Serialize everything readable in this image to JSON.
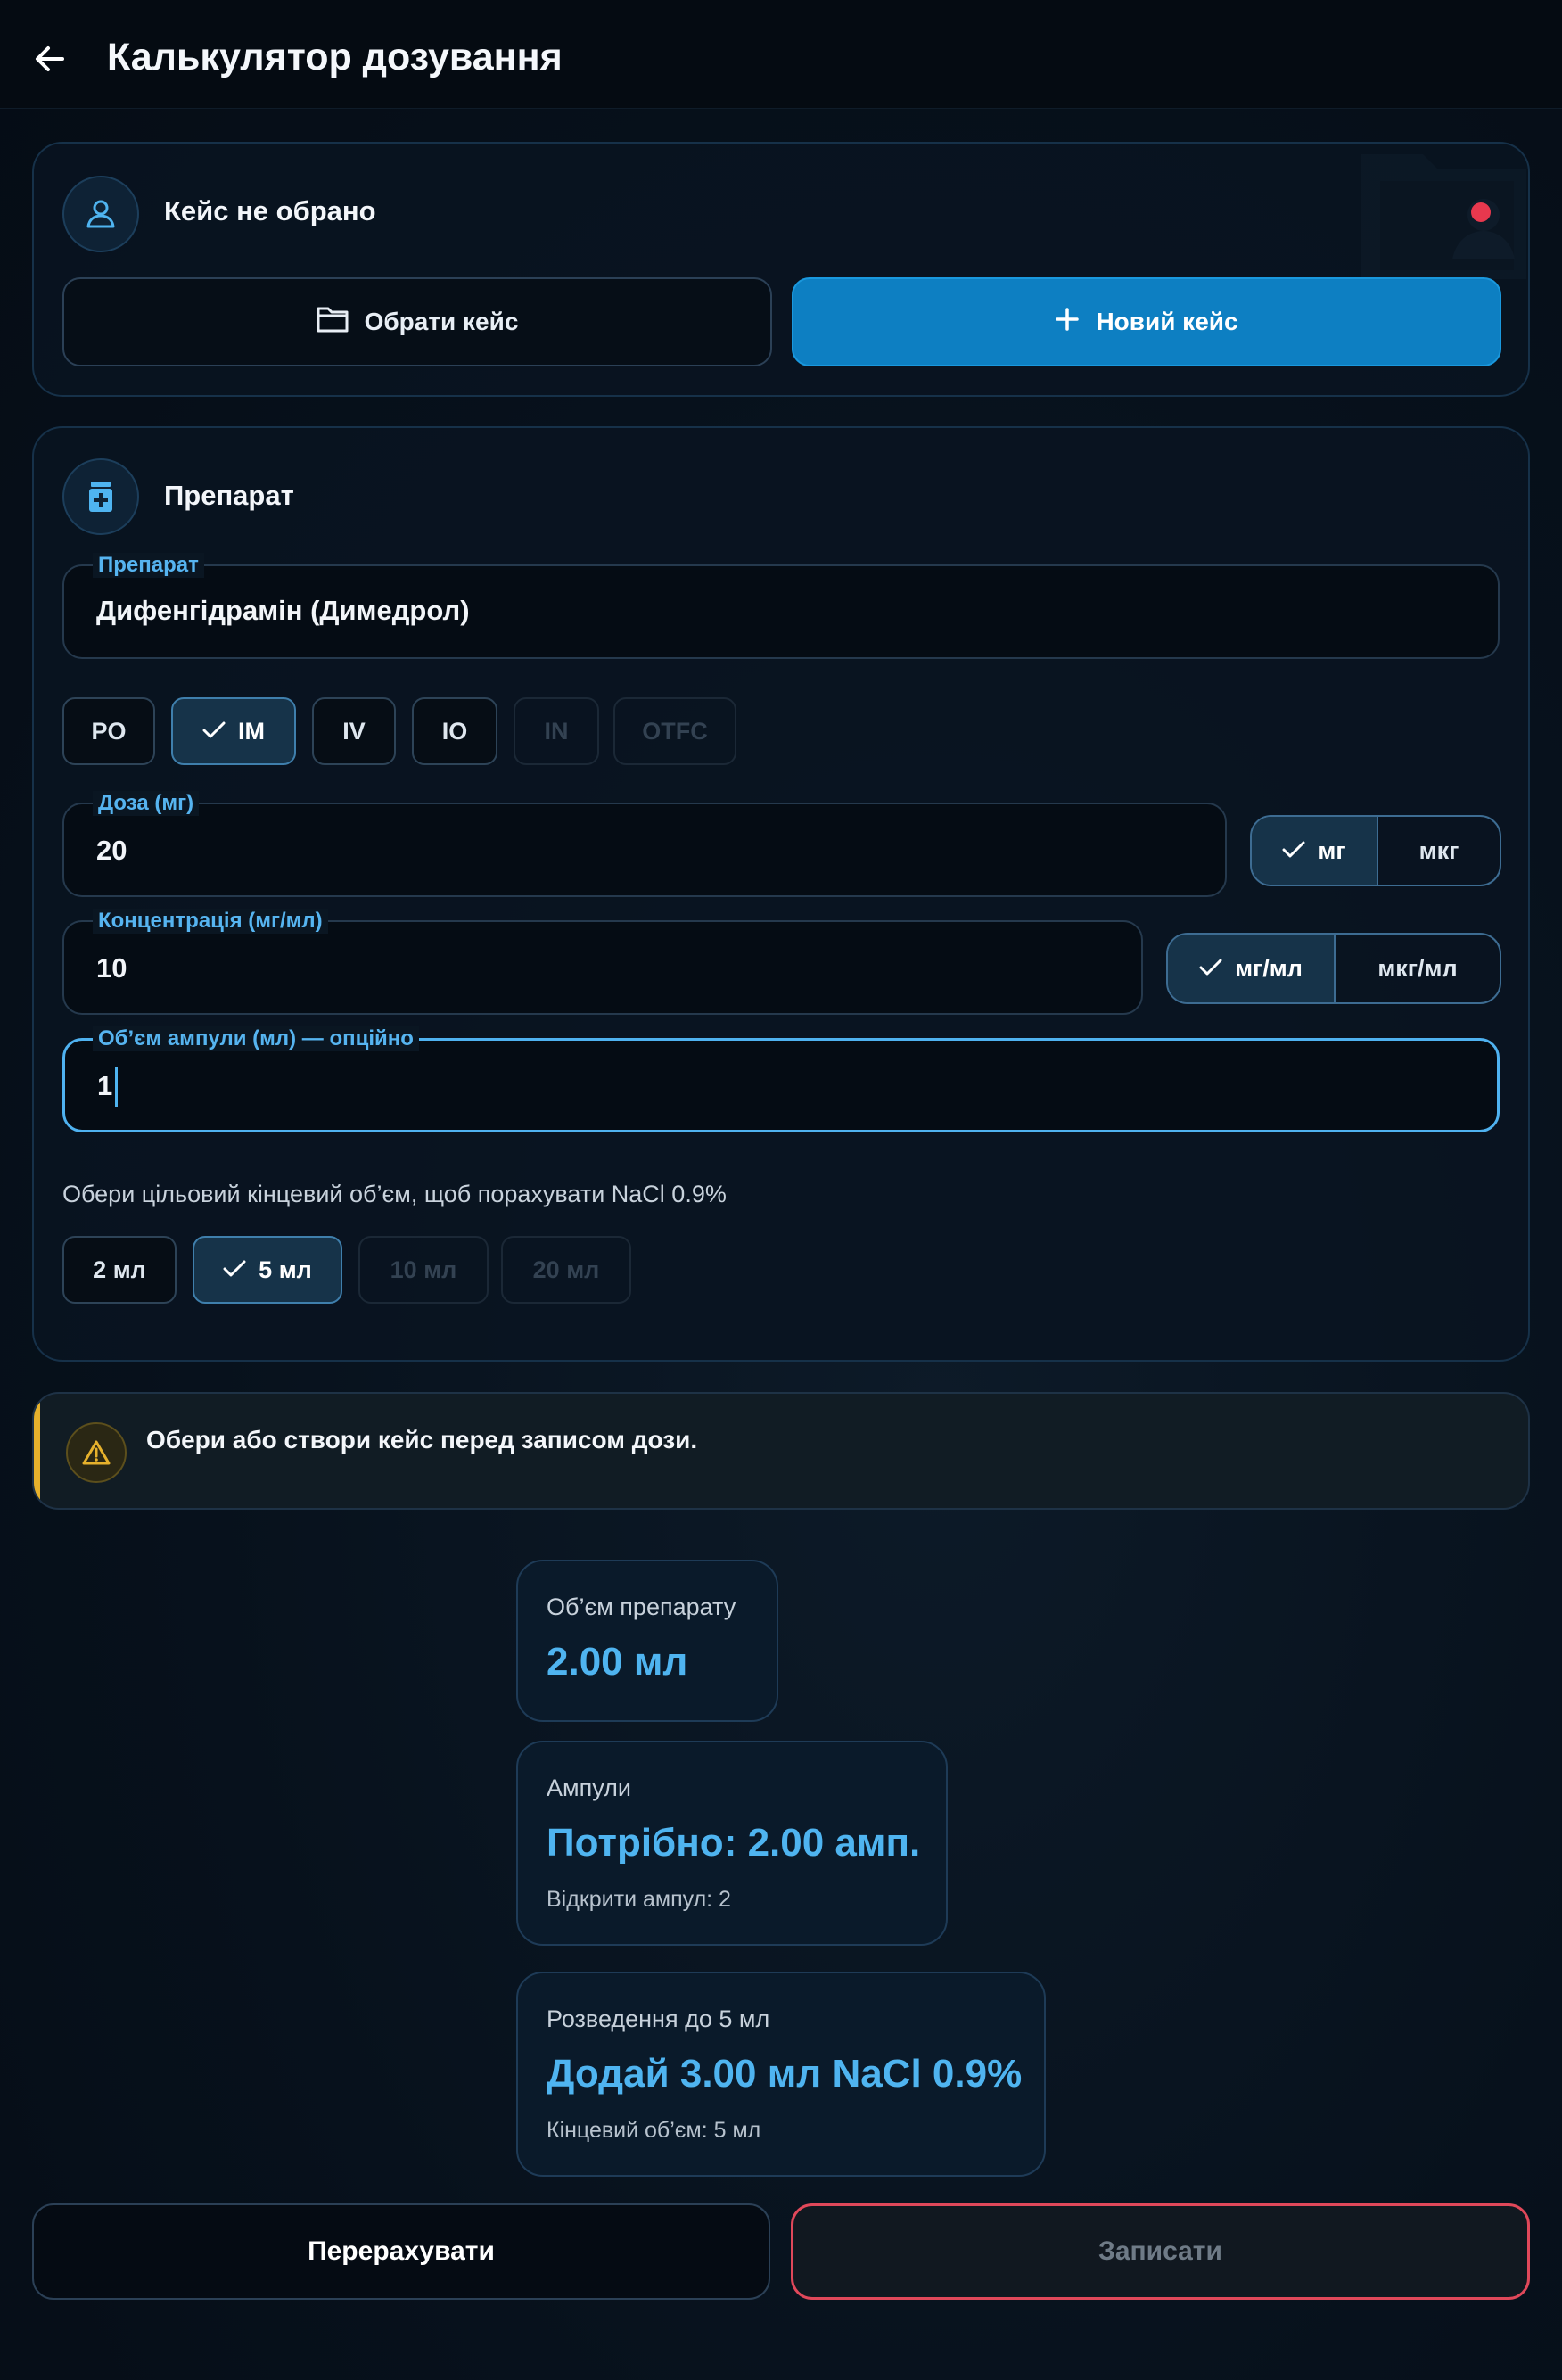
{
  "header": {
    "title": "Калькулятор дозування",
    "back_icon": "arrow-left-icon"
  },
  "case_card": {
    "status": "Кейс не обрано",
    "select_button": "Обрати кейс",
    "new_button": "Новий кейс"
  },
  "drug_card": {
    "heading": "Препарат",
    "drug_field": {
      "label": "Препарат",
      "value": "Дифенгідрамін (Димедрол)"
    },
    "routes": [
      {
        "label": "PO",
        "state": "normal"
      },
      {
        "label": "IM",
        "state": "selected"
      },
      {
        "label": "IV",
        "state": "normal"
      },
      {
        "label": "IO",
        "state": "normal"
      },
      {
        "label": "IN",
        "state": "disabled"
      },
      {
        "label": "OTFC",
        "state": "disabled"
      }
    ],
    "dose_field": {
      "label": "Доза (мг)",
      "value": "20"
    },
    "dose_units": {
      "options": [
        "мг",
        "мкг"
      ],
      "selected": "мг"
    },
    "conc_field": {
      "label": "Концентрація (мг/мл)",
      "value": "10"
    },
    "conc_units": {
      "options": [
        "мг/мл",
        "мкг/мл"
      ],
      "selected": "мг/мл"
    },
    "ampoule_field": {
      "label": "Об’єм ампули (мл) — опційно",
      "value": "1"
    },
    "target_hint": "Обери цільовий кінцевий об’єм, щоб порахувати NaCl 0.9%",
    "target_volumes": [
      {
        "label": "2 мл",
        "state": "normal"
      },
      {
        "label": "5 мл",
        "state": "selected"
      },
      {
        "label": "10 мл",
        "state": "disabled"
      },
      {
        "label": "20 мл",
        "state": "disabled"
      }
    ]
  },
  "warning": {
    "text": "Обери або створи кейс перед записом дози."
  },
  "results": {
    "volume": {
      "label": "Об’єм препарату",
      "value": "2.00 мл"
    },
    "ampoules": {
      "label": "Ампули",
      "value": "Потрібно: 2.00 амп.",
      "sub": "Відкрити ампул: 2"
    },
    "dilution": {
      "label": "Розведення до 5 мл",
      "value": "Додай 3.00 мл NaCl 0.9%",
      "sub": "Кінцевий об’єм: 5 мл"
    }
  },
  "actions": {
    "recalc": "Перерахувати",
    "save": "Записати"
  },
  "colors": {
    "accent": "#4fb4f0",
    "primary": "#0d7fc2",
    "warning": "#e6b12c",
    "danger": "#e0485a"
  }
}
